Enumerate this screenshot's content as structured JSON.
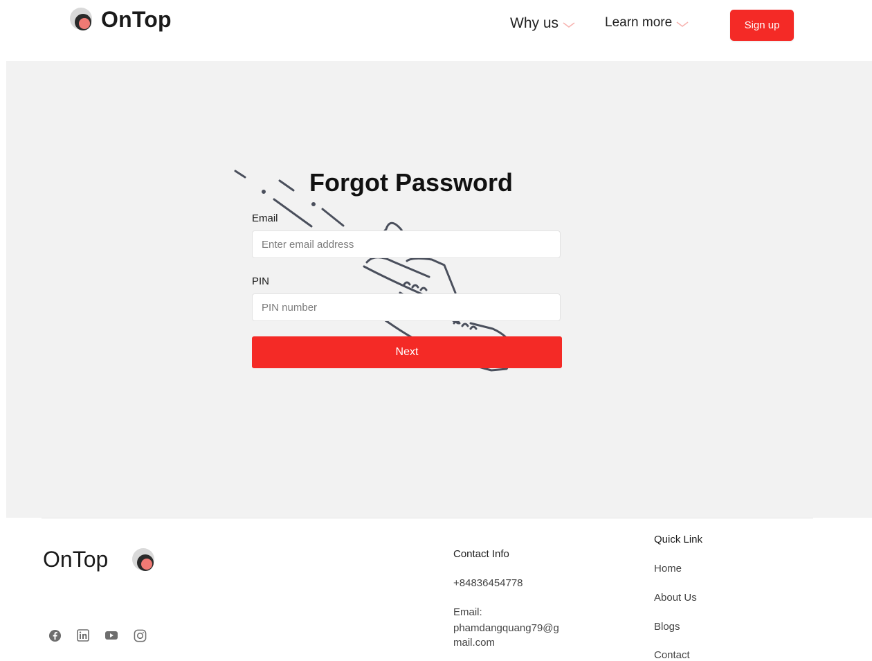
{
  "brand": {
    "name": "OnTop"
  },
  "nav": {
    "why_us": "Why us",
    "learn_more": "Learn more",
    "signup": "Sign up"
  },
  "form": {
    "title": "Forgot Password",
    "email_label": "Email",
    "email_placeholder": "Enter email address",
    "pin_label": "PIN",
    "pin_placeholder": "PIN number",
    "next": "Next"
  },
  "footer": {
    "brand": "OnTop",
    "contact": {
      "title": "Contact Info",
      "phone": "+84836454778",
      "email_label": "Email:",
      "email": "phamdangquang79@gmail.com"
    },
    "quick_links": {
      "title": "Quick Link",
      "items": [
        "Home",
        "About Us",
        "Blogs",
        "Contact"
      ]
    },
    "socials": [
      "facebook-icon",
      "linkedin-icon",
      "youtube-icon",
      "instagram-icon"
    ]
  },
  "colors": {
    "accent": "#f42a26",
    "band": "#f2f2f2",
    "chevron": "#f7b3b0"
  }
}
